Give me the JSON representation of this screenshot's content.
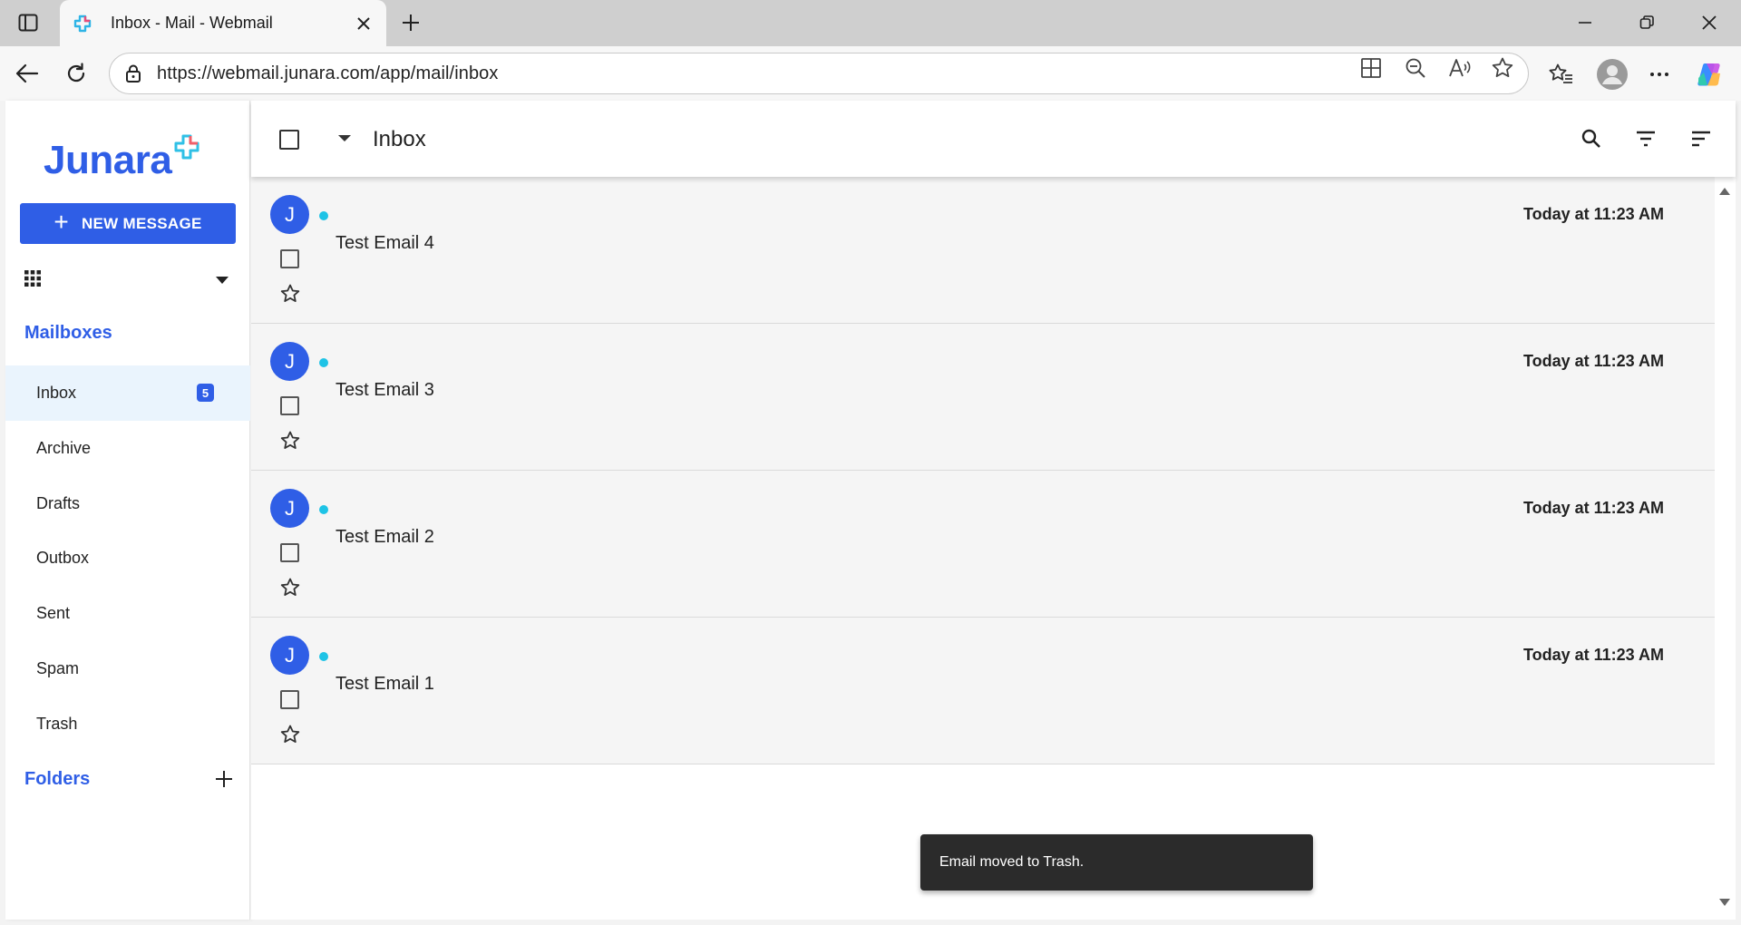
{
  "browser": {
    "tab_title": "Inbox - Mail - Webmail",
    "url": "https://webmail.junara.com/app/mail/inbox"
  },
  "app": {
    "logo_text": "Junara",
    "brand_color": "#2f5ee6",
    "new_message_label": "NEW MESSAGE",
    "mailboxes_title": "Mailboxes",
    "folders_title": "Folders",
    "mailboxes": [
      {
        "label": "Inbox",
        "badge": "5",
        "active": true
      },
      {
        "label": "Archive"
      },
      {
        "label": "Drafts"
      },
      {
        "label": "Outbox"
      },
      {
        "label": "Sent"
      },
      {
        "label": "Spam"
      },
      {
        "label": "Trash"
      }
    ]
  },
  "main": {
    "title": "Inbox",
    "emails": [
      {
        "initial": "J",
        "subject": "Test Email 4",
        "time": "Today at 11:23 AM",
        "unread": true
      },
      {
        "initial": "J",
        "subject": "Test Email 3",
        "time": "Today at 11:23 AM",
        "unread": true
      },
      {
        "initial": "J",
        "subject": "Test Email 2",
        "time": "Today at 11:23 AM",
        "unread": true
      },
      {
        "initial": "J",
        "subject": "Test Email 1",
        "time": "Today at 11:23 AM",
        "unread": true
      }
    ]
  },
  "snackbar": {
    "message": "Email moved to Trash."
  },
  "icons": {
    "tab_actions": "tab-actions-icon",
    "favicon": "junara-favicon-icon",
    "close_tab": "close-icon",
    "new_tab": "plus-icon",
    "minimize": "minimize-icon",
    "restore": "restore-icon",
    "close_window": "close-icon",
    "back": "back-arrow-icon",
    "refresh": "refresh-icon",
    "lock": "lock-icon",
    "apps_grid": "apps-grid-icon",
    "search": "search-icon",
    "filter": "filter-icon",
    "sort": "sort-icon",
    "star": "star-outline-icon"
  }
}
